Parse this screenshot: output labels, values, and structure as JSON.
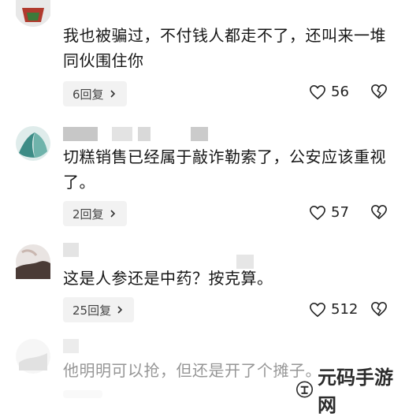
{
  "comments": [
    {
      "text": "我也被骗过，不付钱人都走不了，还叫来一堆同伙围住你",
      "reply_label": "6回复",
      "likes": "56"
    },
    {
      "text": "切糕销售已经属于敲诈勒索了，公安应该重视了。",
      "reply_label": "2回复",
      "likes": "57"
    },
    {
      "text": "这是人参还是中药？按克算。",
      "reply_label": "25回复",
      "likes": "512"
    },
    {
      "text": "他明明可以抢，但还是开了个摊子。"
    }
  ],
  "watermark": {
    "text": "元码手游网"
  },
  "colors": {
    "avatar_red": "#c0392b",
    "avatar_teal": "#3d8c86",
    "name_placeholder": "#cfcfcf",
    "pill_bg": "#f2f2f2"
  },
  "icons": {
    "like": "heart-outline-icon",
    "dislike": "broken-heart-icon",
    "reply_chevron": "chevron-right-icon"
  }
}
